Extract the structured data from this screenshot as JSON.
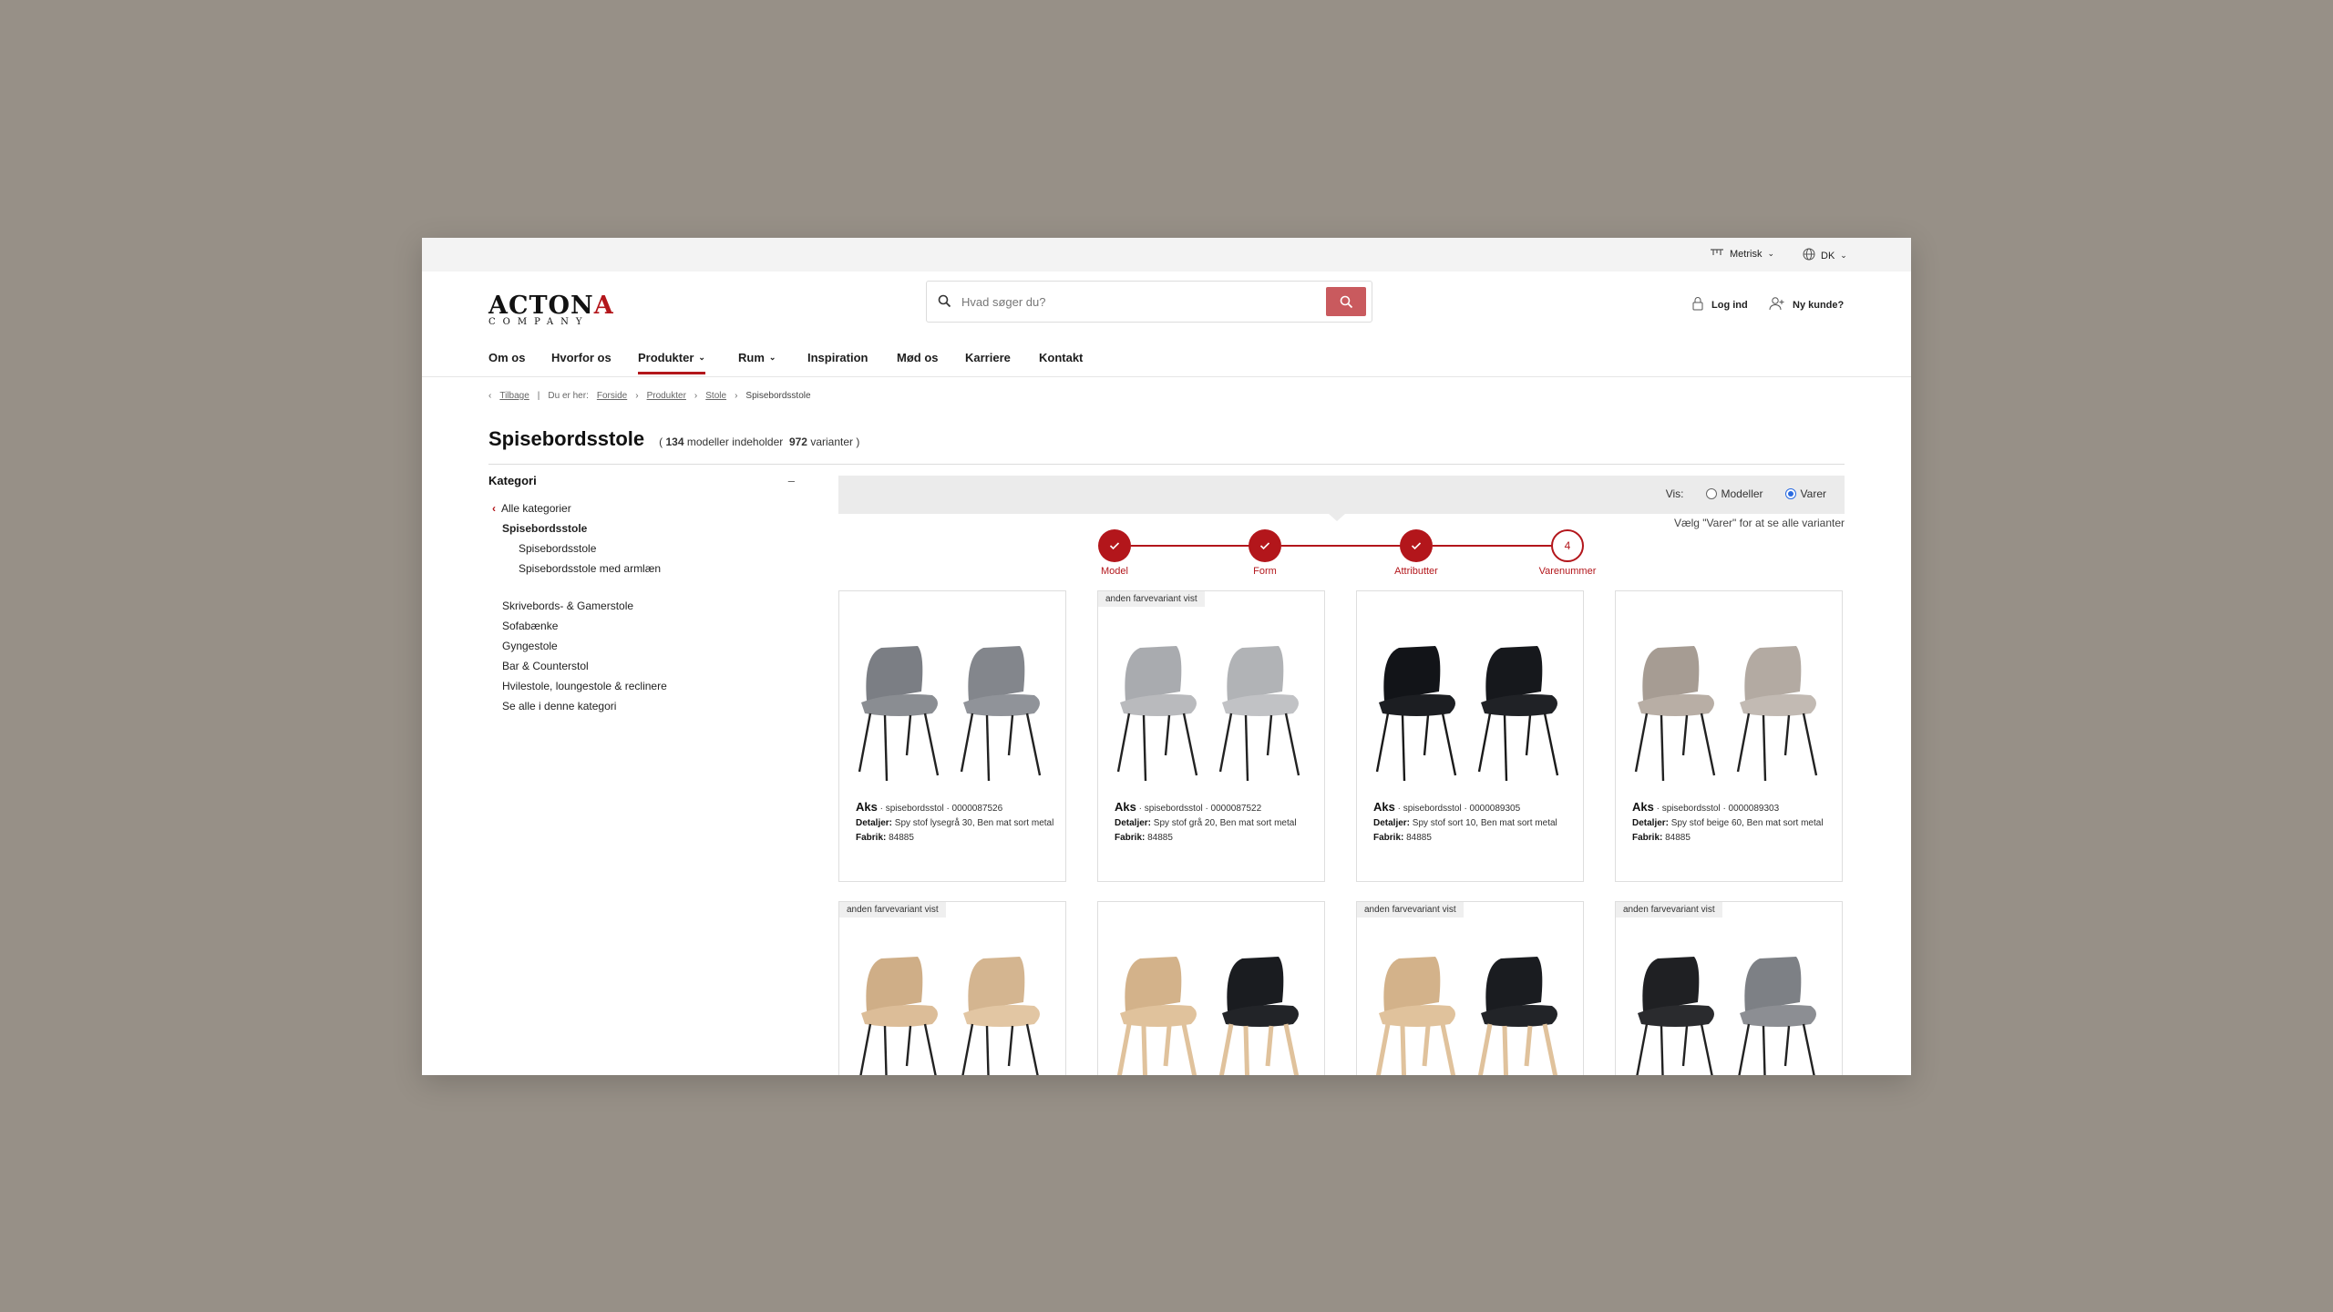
{
  "util": {
    "units_label": "Metrisk",
    "lang_label": "DK"
  },
  "header": {
    "logo_text": "ACTONA",
    "logo_sub": "COMPANY",
    "search_placeholder": "Hvad søger du?",
    "login": "Log ind",
    "new_customer": "Ny kunde?"
  },
  "nav": {
    "items": [
      {
        "label": "Om os"
      },
      {
        "label": "Hvorfor os"
      },
      {
        "label": "Produkter"
      },
      {
        "label": "Rum"
      },
      {
        "label": "Inspiration"
      },
      {
        "label": "Mød os"
      },
      {
        "label": "Karriere"
      },
      {
        "label": "Kontakt"
      }
    ]
  },
  "breadcrumb": {
    "back": "Tilbage",
    "you_are_here": "Du er her:",
    "items": [
      "Forside",
      "Produkter",
      "Stole"
    ],
    "current": "Spisebordsstole"
  },
  "page": {
    "title": "Spisebordsstole",
    "models_count": "134",
    "models_text": "modeller indeholder",
    "variants_count": "972",
    "variants_text": "varianter"
  },
  "sidebar": {
    "heading": "Kategori",
    "collapse_symbol": "–",
    "all": "Alle kategorier",
    "current": "Spisebordsstole",
    "sub": [
      "Spisebordsstole",
      "Spisebordsstole med armlæn"
    ],
    "others": [
      "Skrivebords- & Gamerstole",
      "Sofabænke",
      "Gyngestole",
      "Bar & Counterstol",
      "Hvilestole, loungestole & reclinere",
      "Se alle i denne kategori"
    ]
  },
  "view": {
    "label": "Vis:",
    "option_models": "Modeller",
    "option_items": "Varer",
    "selected": "Varer",
    "hint": "Vælg \"Varer\" for at se alle varianter"
  },
  "steps": [
    {
      "label": "Model",
      "done": true
    },
    {
      "label": "Form",
      "done": true
    },
    {
      "label": "Attributter",
      "done": true
    },
    {
      "label": "Varenummer",
      "done": false,
      "number": "4"
    }
  ],
  "products": [
    {
      "badge": "",
      "name": "Aks",
      "type": "· spisebordsstol · 0000087526",
      "details_label": "Detaljer:",
      "details": "Spy stof lysegrå 30, Ben mat sort metal",
      "factory_label": "Fabrik:",
      "factory": "84885",
      "seat": "#8a8d92",
      "back": "#7b7e84",
      "seat2": "#909399",
      "back2": "#83868c",
      "legs": "#222222"
    },
    {
      "badge": "anden farvevariant vist",
      "name": "Aks",
      "type": "· spisebordsstol · 0000087522",
      "details_label": "Detaljer:",
      "details": "Spy stof grå 20, Ben mat sort metal",
      "factory_label": "Fabrik:",
      "factory": "84885",
      "seat": "#b9babd",
      "back": "#a9abaf",
      "seat2": "#c1c2c5",
      "back2": "#b1b3b6",
      "legs": "#222222"
    },
    {
      "badge": "",
      "name": "Aks",
      "type": "· spisebordsstol · 0000089305",
      "details_label": "Detaljer:",
      "details": "Spy stof sort 10, Ben mat sort metal",
      "factory_label": "Fabrik:",
      "factory": "84885",
      "seat": "#1c1e22",
      "back": "#121418",
      "seat2": "#202226",
      "back2": "#16181c",
      "legs": "#1a1a1a"
    },
    {
      "badge": "",
      "name": "Aks",
      "type": "· spisebordsstol · 0000089303",
      "details_label": "Detaljer:",
      "details": "Spy stof beige 60, Ben mat sort metal",
      "factory_label": "Fabrik:",
      "factory": "84885",
      "seat": "#b8aea5",
      "back": "#a69c93",
      "seat2": "#c2bab3",
      "back2": "#b3aaa2",
      "legs": "#222222"
    },
    {
      "badge": "anden farvevariant vist",
      "name": "",
      "type": "",
      "details_label": "",
      "details": "",
      "factory_label": "",
      "factory": "",
      "seat": "#dcbd98",
      "back": "#cfae87",
      "seat2": "#e2c6a3",
      "back2": "#d4b590",
      "legs": "#222222"
    },
    {
      "badge": "",
      "name": "",
      "type": "",
      "details_label": "",
      "details": "",
      "factory_label": "",
      "factory": "",
      "seat": "#e0c29c",
      "back": "#d3b28a",
      "seat2": "#222428",
      "back2": "#1a1c20",
      "legs": "#e0c29c"
    },
    {
      "badge": "anden farvevariant vist",
      "name": "",
      "type": "",
      "details_label": "",
      "details": "",
      "factory_label": "",
      "factory": "",
      "seat": "#e0c29c",
      "back": "#d3b28a",
      "seat2": "#222428",
      "back2": "#1a1c20",
      "legs": "#e0c29c"
    },
    {
      "badge": "anden farvevariant vist",
      "name": "",
      "type": "",
      "details_label": "",
      "details": "",
      "factory_label": "",
      "factory": "",
      "seat": "#2a2b2e",
      "back": "#1f2023",
      "seat2": "#8c8e93",
      "back2": "#7d8085",
      "legs": "#222222"
    }
  ]
}
